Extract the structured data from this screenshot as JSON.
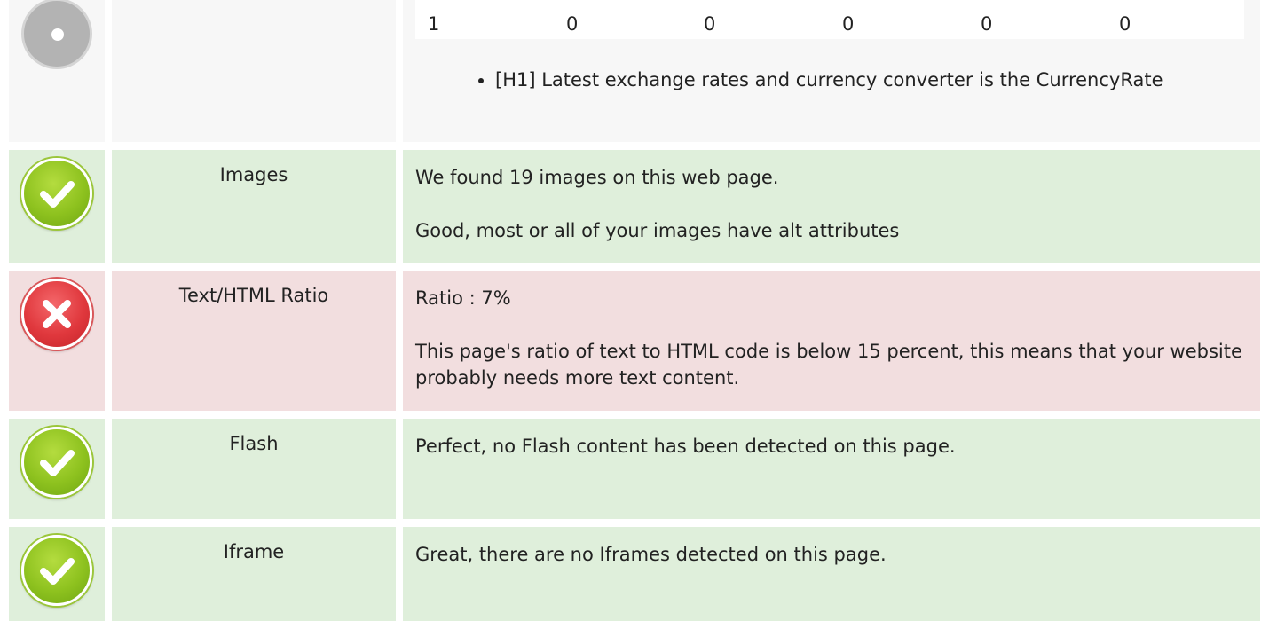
{
  "headings_table": {
    "values": [
      "1",
      "0",
      "0",
      "0",
      "0",
      "0"
    ]
  },
  "headings_list": [
    "[H1] Latest exchange rates and currency converter is the CurrencyRate"
  ],
  "rows": [
    {
      "status": "good",
      "label": "Images",
      "lines": [
        "We found 19 images on this web page.",
        "Good, most or all of your images have alt attributes"
      ]
    },
    {
      "status": "bad",
      "label": "Text/HTML Ratio",
      "lines": [
        "Ratio : 7%",
        "This page's ratio of text to HTML code is below 15 percent, this means that your website probably needs more text content."
      ]
    },
    {
      "status": "good",
      "label": "Flash",
      "lines": [
        "Perfect, no Flash content has been detected on this page."
      ]
    },
    {
      "status": "good",
      "label": "Iframe",
      "lines": [
        "Great, there are no Iframes detected on this page."
      ]
    }
  ],
  "colors": {
    "good_bg": "#dfefdb",
    "bad_bg": "#f2dedf",
    "neutral_bg": "#f7f7f7",
    "good_icon": "#8ec21f",
    "bad_icon": "#e0383d",
    "neutral_icon": "#b3b3b3"
  },
  "icons": {
    "neutral": "info-dot-icon",
    "good": "check-circle-icon",
    "bad": "x-circle-icon"
  }
}
